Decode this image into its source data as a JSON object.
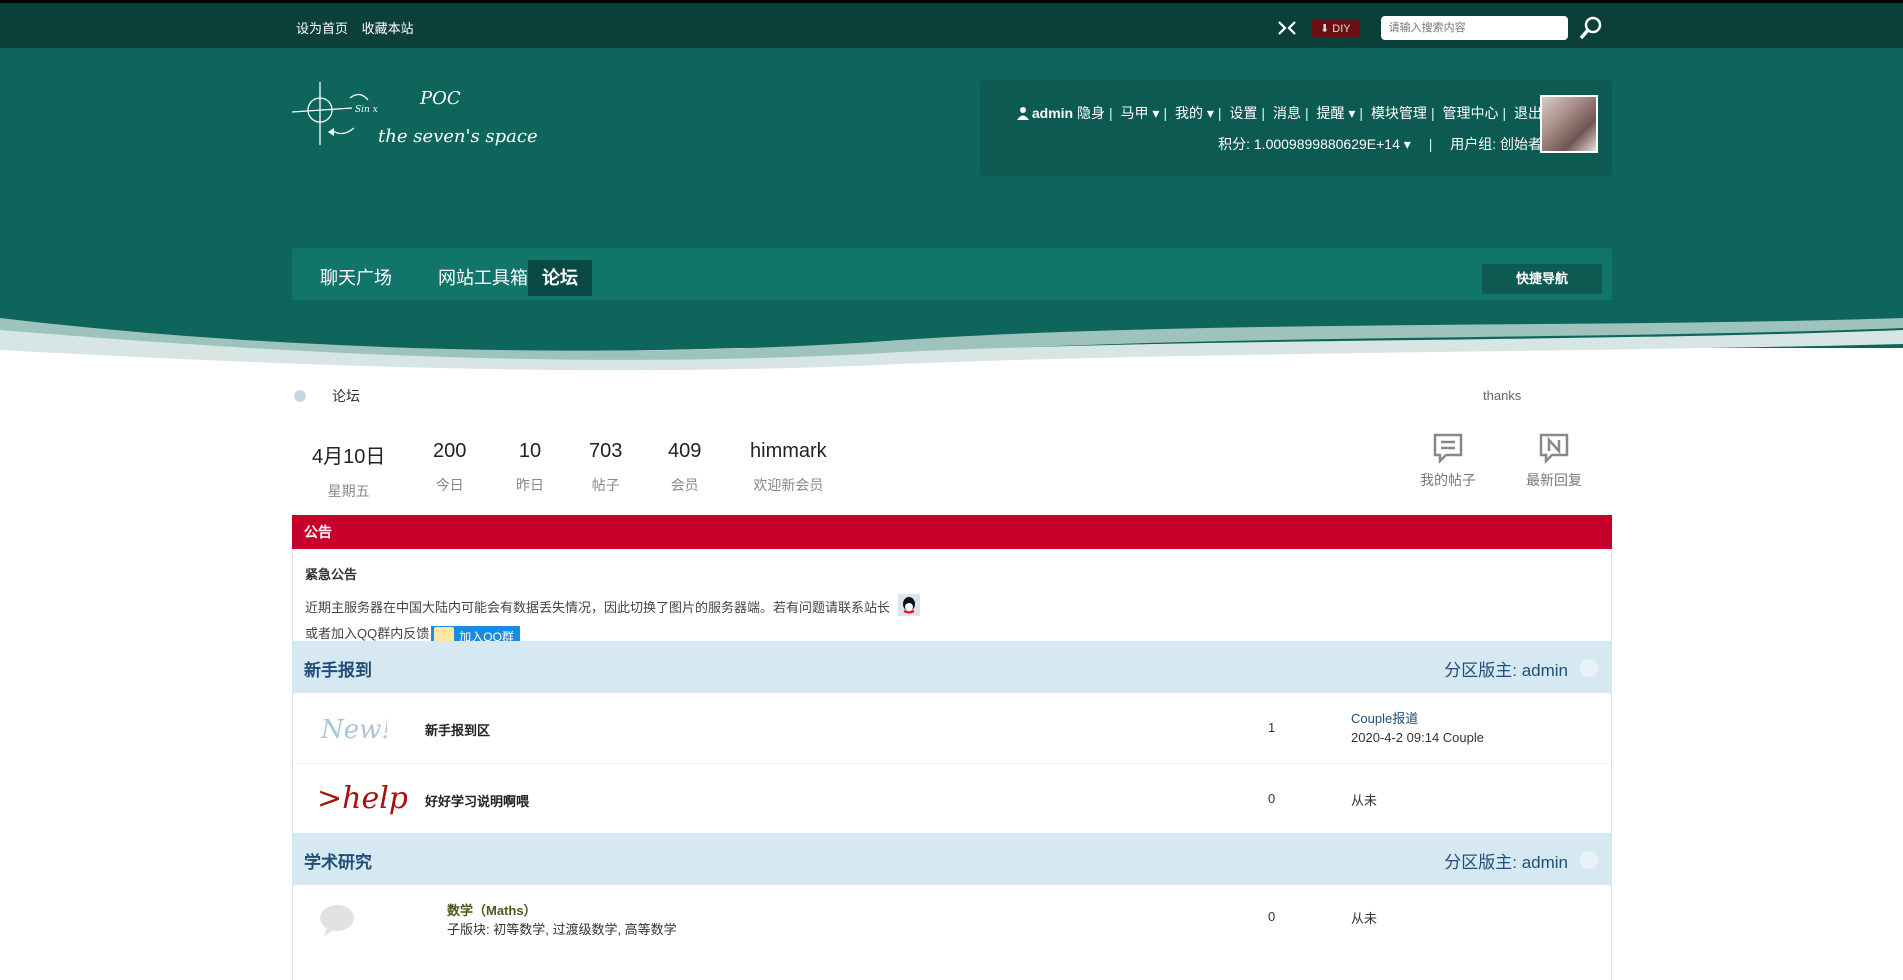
{
  "topbar": {
    "set_home": "设为首页",
    "bookmark": "收藏本站",
    "diy_label": "DIY",
    "search_placeholder": "请输入搜索内容"
  },
  "logo": {
    "title": "POC",
    "subtitle": "the seven's space"
  },
  "user": {
    "name": "admin",
    "invisible": "隐身",
    "menu": [
      "马甲",
      "我的",
      "设置",
      "消息",
      "提醒",
      "模块管理",
      "管理中心",
      "退出"
    ],
    "points_label": "积分: 1.0009899880629E+14",
    "group_label": "用户组: 创始者"
  },
  "nav": {
    "items": [
      "聊天广场",
      "网站工具箱",
      "论坛"
    ],
    "active_index": 2,
    "quick_nav": "快捷导航"
  },
  "breadcrumb": {
    "current": "论坛"
  },
  "welcome": {
    "text": "thanks"
  },
  "stats": [
    {
      "value": "4月10日",
      "label": "星期五"
    },
    {
      "value": "200",
      "label": "今日"
    },
    {
      "value": "10",
      "label": "昨日"
    },
    {
      "value": "703",
      "label": "帖子"
    },
    {
      "value": "409",
      "label": "会员"
    },
    {
      "value": "himmark",
      "label": "欢迎新会员"
    }
  ],
  "actions": {
    "my_posts": "我的帖子",
    "latest_replies": "最新回复"
  },
  "announcement": {
    "bar_title": "公告",
    "heading": "紧急公告",
    "line1": "近期主服务器在中国大陆内可能会有数据丢失情况，因此切换了图片的服务器端。若有问题请联系站长",
    "line2": "或者加入QQ群内反馈",
    "qq_group_button": "加入QQ群"
  },
  "sections": [
    {
      "title": "新手报到",
      "moderator": "分区版主: admin",
      "forums": [
        {
          "name": "新手报到区",
          "icon_text": "New!",
          "count": "1",
          "last_line1": "Couple报道",
          "last_line2": "2020-4-2 09:14 Couple"
        },
        {
          "name": "好好学习说明啊喂",
          "icon_text": ">help",
          "count": "0",
          "last_line1": "从未"
        }
      ]
    },
    {
      "title": "学术研究",
      "moderator": "分区版主: admin",
      "forums": [
        {
          "name": "数学（Maths）",
          "sub": "子版块: 初等数学, 过渡级数学, 高等数学",
          "count": "0",
          "last_line1": "从未"
        }
      ]
    }
  ],
  "colors": {
    "header": "#0d655b",
    "topbar": "#0b3f3a",
    "announce": "#c8002c",
    "section": "#d6e9f3"
  }
}
